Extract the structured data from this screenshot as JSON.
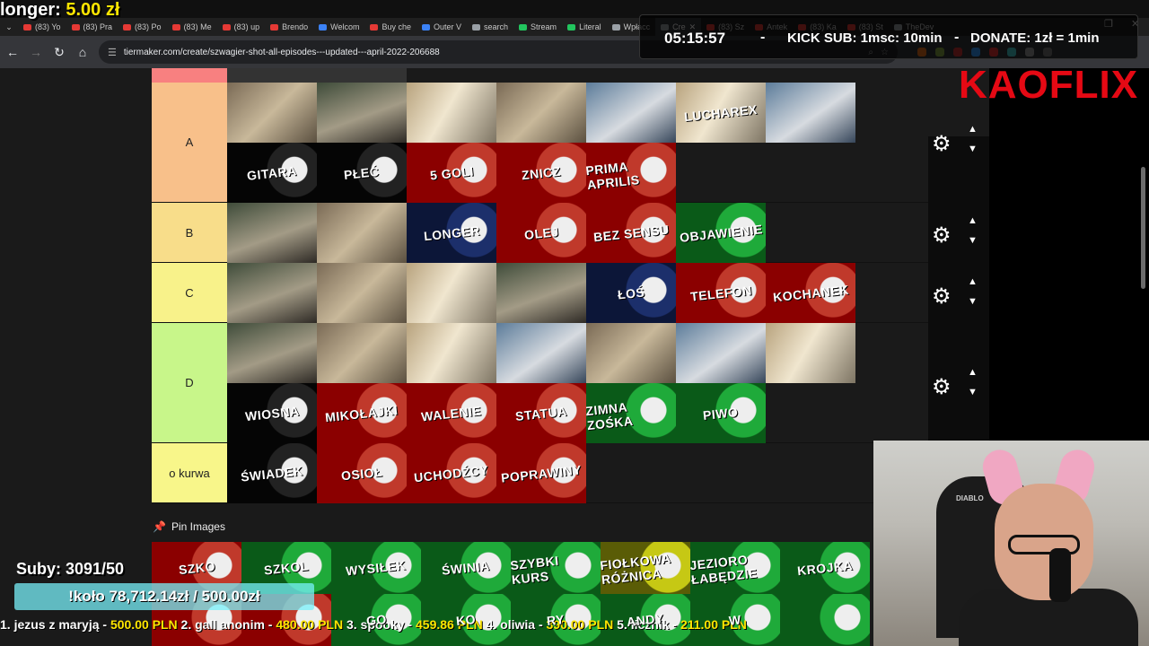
{
  "overlay": {
    "top_left_label": "longer:",
    "top_left_amount": "5.00 zł",
    "clock": "05:15:57",
    "kick_sub": "KICK SUB: 1msc: 10min",
    "donate": "DONATE: 1zł = 1min",
    "brand": "KAOFLIX",
    "suby": "Suby: 3091/50",
    "kolo": "!koło 78,712.14zł / 500.00zł",
    "ticker": [
      {
        "name": "1. jezus z maryją - ",
        "amt": "500.00 PLN"
      },
      {
        "name": " 2. gall anonim - ",
        "amt": "480.00 PLN"
      },
      {
        "name": " 3. spooky - ",
        "amt": "459.86 PLN"
      },
      {
        "name": " 4. oliwia - ",
        "amt": "390.00 PLN"
      },
      {
        "name": " 5. licznik - ",
        "amt": "211.00 PLN"
      }
    ],
    "webcam_logo": "DIABLO"
  },
  "browser": {
    "tabs": [
      {
        "label": "(83) Yo",
        "fav": "red"
      },
      {
        "label": "(83) Pra",
        "fav": "red"
      },
      {
        "label": "(83) Po",
        "fav": "red"
      },
      {
        "label": "(83) Me",
        "fav": "red"
      },
      {
        "label": "(83) up",
        "fav": "red"
      },
      {
        "label": "Brendo",
        "fav": "red"
      },
      {
        "label": "Welcom",
        "fav": "blue"
      },
      {
        "label": "Buy che",
        "fav": "red"
      },
      {
        "label": "Outer V",
        "fav": "blue"
      },
      {
        "label": "search",
        "fav": "grey"
      },
      {
        "label": "Stream",
        "fav": "green"
      },
      {
        "label": "Literal",
        "fav": "green"
      },
      {
        "label": "Wpłacc",
        "fav": "grey"
      },
      {
        "label": "Cre",
        "fav": "grey",
        "active": true
      },
      {
        "label": "(83) Sz",
        "fav": "red"
      },
      {
        "label": "Antek",
        "fav": "red"
      },
      {
        "label": "(83) Ka",
        "fav": "red"
      },
      {
        "label": "(83) St",
        "fav": "red"
      },
      {
        "label": "TheDev",
        "fav": "grey"
      }
    ],
    "url": "tiermaker.com/create/szwagier-shot-all-episodes---updated---april-2022-206688"
  },
  "tiers": [
    {
      "label": "A",
      "color": "#f8c08a",
      "items": [
        {
          "caption": "",
          "style": "photo"
        },
        {
          "caption": "",
          "style": "photo p2"
        },
        {
          "caption": "",
          "style": "photo p3"
        },
        {
          "caption": "",
          "style": "photo"
        },
        {
          "caption": "",
          "style": "photo p4"
        },
        {
          "caption": "LUCHAREX",
          "style": "photo p3"
        },
        {
          "caption": "",
          "style": "photo p4"
        },
        {
          "caption": "GITARA",
          "style": "sh blk"
        },
        {
          "caption": "PŁEĆ",
          "style": "sh blk"
        },
        {
          "caption": "5 GOLI",
          "style": "sh"
        },
        {
          "caption": "ZNICZ",
          "style": "sh"
        },
        {
          "caption": "PRIMA APRILIS",
          "style": "sh"
        }
      ]
    },
    {
      "label": "B",
      "color": "#f8dd8a",
      "items": [
        {
          "caption": "",
          "style": "photo p2"
        },
        {
          "caption": "",
          "style": "photo"
        },
        {
          "caption": "LONGER",
          "style": "sh nav"
        },
        {
          "caption": "OLEJ",
          "style": "sh"
        },
        {
          "caption": "BEZ SENSU",
          "style": "sh"
        },
        {
          "caption": "OBJAWIENIE",
          "style": "sh grn"
        }
      ]
    },
    {
      "label": "C",
      "color": "#f8f28a",
      "items": [
        {
          "caption": "",
          "style": "photo p2"
        },
        {
          "caption": "",
          "style": "photo"
        },
        {
          "caption": "",
          "style": "photo p3"
        },
        {
          "caption": "",
          "style": "photo p2"
        },
        {
          "caption": "ŁOŚ",
          "style": "sh nav"
        },
        {
          "caption": "TELEFON",
          "style": "sh"
        },
        {
          "caption": "KOCHANEK",
          "style": "sh"
        }
      ]
    },
    {
      "label": "D",
      "color": "#c8f68a",
      "items": [
        {
          "caption": "",
          "style": "photo p2"
        },
        {
          "caption": "",
          "style": "photo"
        },
        {
          "caption": "",
          "style": "photo p3"
        },
        {
          "caption": "",
          "style": "photo p4"
        },
        {
          "caption": "",
          "style": "photo"
        },
        {
          "caption": "",
          "style": "photo p4"
        },
        {
          "caption": "",
          "style": "photo p3"
        },
        {
          "caption": "WIOSNA",
          "style": "sh blk"
        },
        {
          "caption": "MIKOŁAJKI",
          "style": "sh"
        },
        {
          "caption": "WALENIE",
          "style": "sh"
        },
        {
          "caption": "STATUA",
          "style": "sh"
        },
        {
          "caption": "ZIMNA ZOŚKA",
          "style": "sh grn"
        },
        {
          "caption": "PIWO",
          "style": "sh grn"
        }
      ]
    },
    {
      "label": "o kurwa",
      "color": "#f8f68a",
      "items": [
        {
          "caption": "ŚWIADEK",
          "style": "sh blk"
        },
        {
          "caption": "OSIOŁ",
          "style": "sh"
        },
        {
          "caption": "UCHODŹCY",
          "style": "sh"
        },
        {
          "caption": "POPRAWINY",
          "style": "sh"
        }
      ]
    }
  ],
  "pin_label": "Pin Images",
  "pool": [
    {
      "caption": "SZKO",
      "style": "sh"
    },
    {
      "caption": "SZKOL",
      "style": "sh grn"
    },
    {
      "caption": "WYSIŁEK",
      "style": "sh grn"
    },
    {
      "caption": "ŚWINIA",
      "style": "sh grn"
    },
    {
      "caption": "SZYBKI KURS",
      "style": "sh grn"
    },
    {
      "caption": "FIOŁKOWA RÓŻNICA",
      "style": "sh yel"
    },
    {
      "caption": "JEZIORO ŁABĘDZIE",
      "style": "sh grn"
    },
    {
      "caption": "KROJKA",
      "style": "sh grn"
    },
    {
      "caption": "",
      "style": "sh"
    },
    {
      "caption": "",
      "style": "sh"
    },
    {
      "caption": "GO",
      "style": "sh grn"
    },
    {
      "caption": "KO",
      "style": "sh grn"
    },
    {
      "caption": "RY",
      "style": "sh grn"
    },
    {
      "caption": "ANDY",
      "style": "sh grn"
    },
    {
      "caption": "W",
      "style": "sh grn"
    },
    {
      "caption": "",
      "style": "sh grn"
    }
  ]
}
